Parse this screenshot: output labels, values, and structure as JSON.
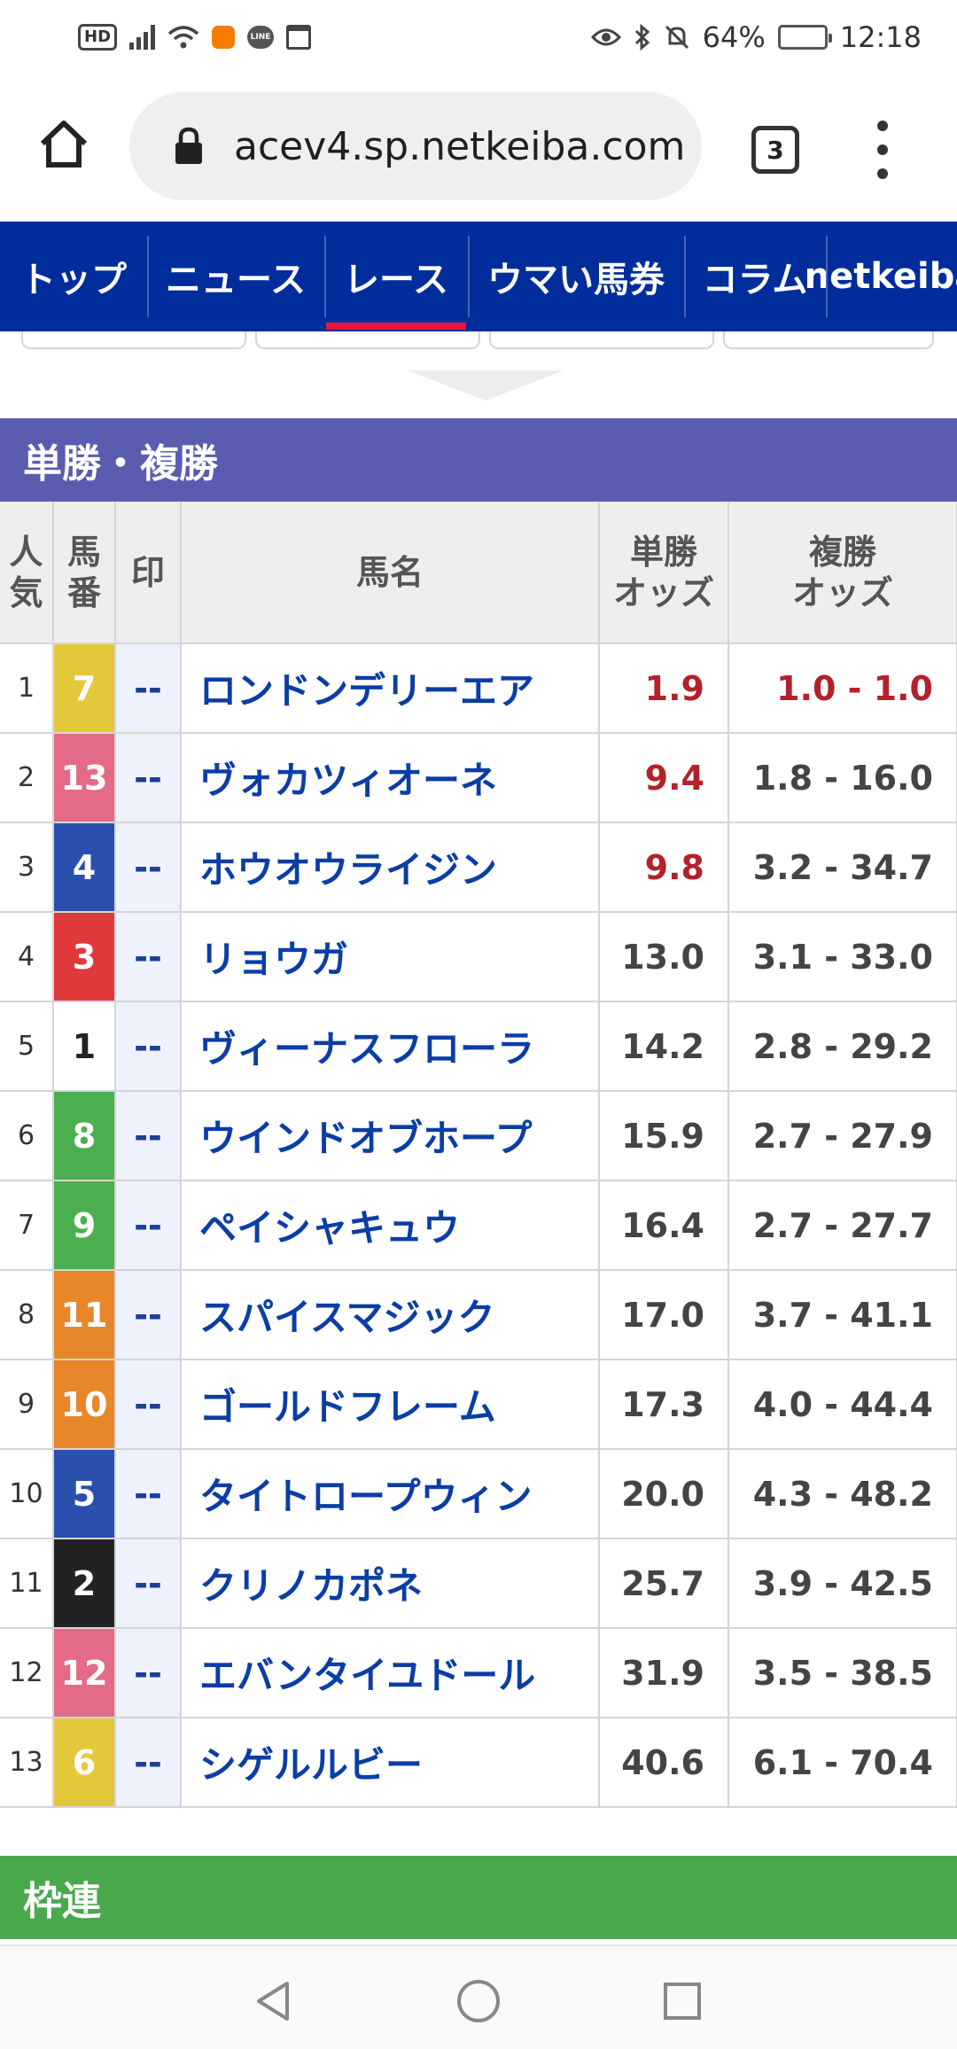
{
  "status_bar": {
    "hd": "HD",
    "line_label": "LINE",
    "battery": "64%",
    "time": "12:18"
  },
  "browser": {
    "url": "acev4.sp.netkeiba.com",
    "tab_count": "3"
  },
  "nav": {
    "items": [
      {
        "label": "トップ",
        "width": 166
      },
      {
        "label": "ニュース",
        "width": 200
      },
      {
        "label": "レース",
        "width": 162
      },
      {
        "label": "ウマい馬券",
        "width": 244
      },
      {
        "label": "コラム",
        "width": 160
      },
      {
        "label": "netkeiba",
        "width": 148
      }
    ],
    "active": "レース"
  },
  "win_place": {
    "title": "単勝・複勝",
    "headers": {
      "ninki": "人気",
      "umaban": "馬番",
      "mark": "印",
      "name": "馬名",
      "tansho_line1": "単勝",
      "tansho_line2": "オッズ",
      "fukusho_line1": "複勝",
      "fukusho_line2": "オッズ"
    },
    "rows": [
      {
        "ninki": "1",
        "umaban": "7",
        "mark": "--",
        "name": "ロンドンデリーエア",
        "tansho": "1.9",
        "fukusho": "1.0 - 1.0",
        "hot_tan": true,
        "hot_fuku": true
      },
      {
        "ninki": "2",
        "umaban": "13",
        "mark": "--",
        "name": "ヴォカツィオーネ",
        "tansho": "9.4",
        "fukusho": "1.8 - 16.0",
        "hot_tan": true,
        "hot_fuku": false
      },
      {
        "ninki": "3",
        "umaban": "4",
        "mark": "--",
        "name": "ホウオウライジン",
        "tansho": "9.8",
        "fukusho": "3.2 - 34.7",
        "hot_tan": true,
        "hot_fuku": false
      },
      {
        "ninki": "4",
        "umaban": "3",
        "mark": "--",
        "name": "リョウガ",
        "tansho": "13.0",
        "fukusho": "3.1 - 33.0",
        "hot_tan": false,
        "hot_fuku": false
      },
      {
        "ninki": "5",
        "umaban": "1",
        "mark": "--",
        "name": "ヴィーナスフローラ",
        "tansho": "14.2",
        "fukusho": "2.8 - 29.2",
        "hot_tan": false,
        "hot_fuku": false
      },
      {
        "ninki": "6",
        "umaban": "8",
        "mark": "--",
        "name": "ウインドオブホープ",
        "tansho": "15.9",
        "fukusho": "2.7 - 27.9",
        "hot_tan": false,
        "hot_fuku": false
      },
      {
        "ninki": "7",
        "umaban": "9",
        "mark": "--",
        "name": "ペイシャキュウ",
        "tansho": "16.4",
        "fukusho": "2.7 - 27.7",
        "hot_tan": false,
        "hot_fuku": false
      },
      {
        "ninki": "8",
        "umaban": "11",
        "mark": "--",
        "name": "スパイスマジック",
        "tansho": "17.0",
        "fukusho": "3.7 - 41.1",
        "hot_tan": false,
        "hot_fuku": false
      },
      {
        "ninki": "9",
        "umaban": "10",
        "mark": "--",
        "name": "ゴールドフレーム",
        "tansho": "17.3",
        "fukusho": "4.0 - 44.4",
        "hot_tan": false,
        "hot_fuku": false
      },
      {
        "ninki": "10",
        "umaban": "5",
        "mark": "--",
        "name": "タイトロープウィン",
        "tansho": "20.0",
        "fukusho": "4.3 - 48.2",
        "hot_tan": false,
        "hot_fuku": false
      },
      {
        "ninki": "11",
        "umaban": "2",
        "mark": "--",
        "name": "クリノカポネ",
        "tansho": "25.7",
        "fukusho": "3.9 - 42.5",
        "hot_tan": false,
        "hot_fuku": false
      },
      {
        "ninki": "12",
        "umaban": "12",
        "mark": "--",
        "name": "エバンタイユドール",
        "tansho": "31.9",
        "fukusho": "3.5 - 38.5",
        "hot_tan": false,
        "hot_fuku": false
      },
      {
        "ninki": "13",
        "umaban": "6",
        "mark": "--",
        "name": "シゲルルビー",
        "tansho": "40.6",
        "fukusho": "6.1 - 70.4",
        "hot_tan": false,
        "hot_fuku": false
      }
    ]
  },
  "bracket_section": {
    "title": "枠連"
  },
  "colors": {
    "nav_bg": "#002d9b",
    "nav_active": "#e8173a",
    "section_purple": "#5a5cb0",
    "section_green": "#4aa84d",
    "hot_odds": "#b3212b",
    "horse_name": "#0a3ea6",
    "gate": {
      "1": {
        "bg": "#ffffff",
        "fg": "#222222"
      },
      "2": {
        "bg": "#222222",
        "fg": "#ffffff"
      },
      "3": {
        "bg": "#e0393b",
        "fg": "#ffffff"
      },
      "4": {
        "bg": "#2b4fad",
        "fg": "#ffffff"
      },
      "5": {
        "bg": "#e3c93a",
        "fg": "#ffffff"
      },
      "6": {
        "bg": "#4caf4f",
        "fg": "#ffffff"
      },
      "7": {
        "bg": "#e8872a",
        "fg": "#ffffff"
      },
      "8": {
        "bg": "#e46b86",
        "fg": "#ffffff"
      }
    }
  },
  "gate_of_umaban": {
    "1": "1",
    "2": "2",
    "3": "3",
    "4": "4",
    "5": "4",
    "6": "5",
    "7": "5",
    "8": "6",
    "9": "6",
    "10": "7",
    "11": "7",
    "12": "8",
    "13": "8"
  }
}
